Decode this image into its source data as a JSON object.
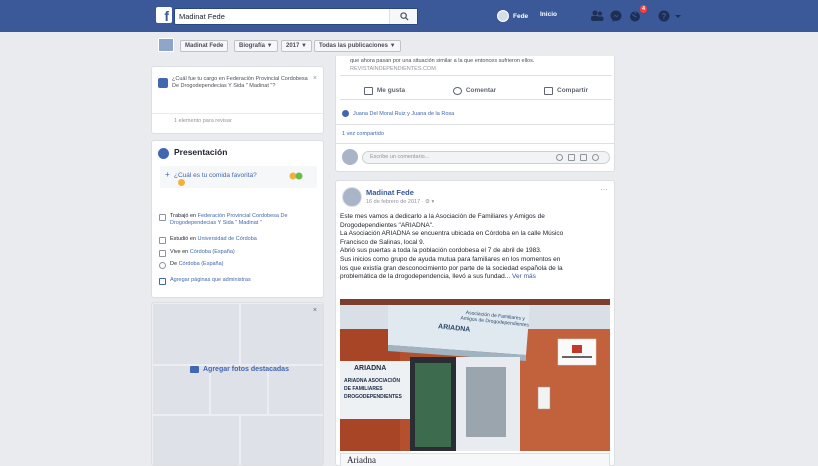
{
  "topbar": {
    "search_value": "Madinat Fede",
    "user_name": "Fede",
    "home_label": "Inicio",
    "notifications_count": "4"
  },
  "profile_nav": {
    "name_label": "Madinat Fede",
    "biography_label": "Biografía ▼",
    "year_label": "2017 ▼",
    "posts_filter_label": "Todas las publicaciones ▼"
  },
  "question_card": {
    "text": "¿Cuál fue tu cargo en Federación Provincial Cordobesa De Drogodependecias Y Sida \" Madinat \"?",
    "close": "×",
    "review": "1 elemento para revisar"
  },
  "presentation": {
    "title": "Presentación",
    "favorite_food": "¿Cuál es tu comida favorita?",
    "items": [
      {
        "prefix": "Trabajó en ",
        "link": "Federación Provincial Cordobesa De Drogodependecias Y Sida \" Madinat \"",
        "suffix": ""
      },
      {
        "prefix": "Estudió en ",
        "link": "Universidad de Córdoba",
        "suffix": ""
      },
      {
        "prefix": "Vive en ",
        "link": "Córdoba (España)",
        "suffix": ""
      },
      {
        "prefix": "De ",
        "link": "Córdoba (España)",
        "suffix": ""
      }
    ],
    "add_pages": "Agregar páginas que administras"
  },
  "featured_photos": {
    "add_label": "Agregar fotos destacadas",
    "close": "×"
  },
  "post1": {
    "link_text": "que ahora pasan por una situación similar a la que entonces sufrieron ellos.",
    "link_domain": "REVISTAINDEPENDIENTES.COM",
    "actions": {
      "like": "Me gusta",
      "comment": "Comentar",
      "share": "Compartir"
    },
    "reactors": "Juana Del Moral Ruiz y Juana de la Rosa",
    "shared_count": "1 vez compartido",
    "comment_placeholder": "Escribe un comentario..."
  },
  "post2": {
    "author": "Madinat Fede",
    "date": "16 de febrero de 2017 · ⚙ ▾",
    "more_icon": "···",
    "body_lines": [
      "Este mes vamos a dedicarlo a la Asociación de Familiares y Amigos de",
      "Drogodependientes \"ARIADNA\".",
      "La Asociación ARIADNA se encuentra ubicada en Córdoba en la calle Músico",
      "Francisco de Salinas, local 9.",
      "Abrió sus puertas a toda la población cordobesa el 7 de abril de 1983.",
      "Sus inicios como grupo de ayuda mutua para familiares en los momentos en",
      "los que existía gran desconocimiento por parte de la sociedad española de la",
      "problemática de la drogodependencia, llevó a sus fundad..."
    ],
    "see_more": "Ver más",
    "photo_sign_top": "Asociación de Familiares y Amigos de Drogodependientes",
    "photo_sign_name": "ARIADNA",
    "photo_sign_small": "ARIADNA ASOCIACIÓN DE FAMILIARES DROGODEPENDIENTES",
    "photo_board_title": "ARIADNA",
    "caption": "Ariadna"
  },
  "colors": {
    "brand": "#3b5998",
    "link": "#365899",
    "background": "#e9ebee"
  }
}
